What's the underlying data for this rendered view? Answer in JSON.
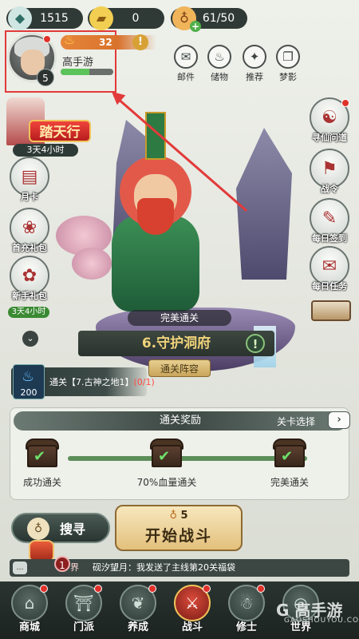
{
  "resources": {
    "stamina": "1515",
    "ingots": "0",
    "gourd": "61/50"
  },
  "player": {
    "name": "高手游",
    "level": "5",
    "power": "32",
    "exp_fraction": 0.55
  },
  "top_buttons": [
    {
      "icon": "mail-icon",
      "glyph": "✉",
      "label": "邮件"
    },
    {
      "icon": "gift-bag-icon",
      "glyph": "♨",
      "label": "储物"
    },
    {
      "icon": "sparkle-icon",
      "glyph": "✦",
      "label": "推荐"
    },
    {
      "icon": "scroll-icon",
      "glyph": "❐",
      "label": "梦影"
    }
  ],
  "event": {
    "title": "踏天行",
    "timer": "3天4小时"
  },
  "left_buttons": [
    {
      "icon": "card-icon",
      "glyph": "▤",
      "label": "月卡"
    },
    {
      "icon": "first-charge-icon",
      "glyph": "❀",
      "label": "首充礼包"
    },
    {
      "icon": "newbie-gift-icon",
      "glyph": "✿",
      "label": "新手礼包"
    }
  ],
  "left_timer": "3天4小时",
  "right_buttons": [
    {
      "icon": "immortal-path-icon",
      "glyph": "☯",
      "label": "寻仙问道"
    },
    {
      "icon": "battle-order-icon",
      "glyph": "⚑",
      "label": "战令"
    },
    {
      "icon": "daily-sign-icon",
      "glyph": "✎",
      "label": "每日签到"
    },
    {
      "icon": "daily-task-icon",
      "glyph": "✉",
      "label": "每日任务"
    }
  ],
  "stage": {
    "perfect_label": "完美通关",
    "name": "6.守护洞府",
    "lineup_button": "通关阵容"
  },
  "quest": {
    "count": "200",
    "prefix": "通关【7.古神之地1】",
    "progress": "(0/1)"
  },
  "rewards": {
    "title": "通关奖励",
    "stage_select": "关卡选择",
    "items": [
      {
        "label": "成功通关",
        "claimed": true
      },
      {
        "label": "70%血量通关",
        "claimed": true
      },
      {
        "label": "完美通关",
        "claimed": true
      }
    ]
  },
  "actions": {
    "search_label": "搜寻",
    "start_cost": "5",
    "start_label": "开始战斗"
  },
  "chat": {
    "badge": "1",
    "channel": "界",
    "message": "砚汐望月：我发送了主线第20关福袋"
  },
  "nav": [
    {
      "icon": "shop-icon",
      "glyph": "⌂",
      "label": "商城",
      "active": false
    },
    {
      "icon": "sect-icon",
      "glyph": "⛩",
      "label": "门派",
      "active": false
    },
    {
      "icon": "cultivate-icon",
      "glyph": "❦",
      "label": "养成",
      "active": false
    },
    {
      "icon": "battle-icon",
      "glyph": "⚔",
      "label": "战斗",
      "active": true
    },
    {
      "icon": "cultivator-icon",
      "glyph": "☃",
      "label": "修士",
      "active": false
    },
    {
      "icon": "world-icon",
      "glyph": "◎",
      "label": "世界",
      "active": false
    }
  ],
  "watermark": {
    "brand": "G 高手游",
    "url": "GAOSHOUYOU.COM"
  },
  "colors": {
    "highlight": "#e23a3a",
    "panel_dark": "#2f3a36",
    "gold": "#e3c07c"
  }
}
